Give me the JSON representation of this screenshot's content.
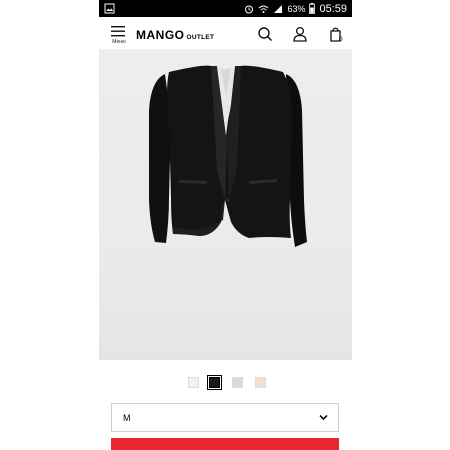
{
  "status_bar": {
    "battery_percent": "63%",
    "time": "05:59",
    "icons": [
      "image-icon",
      "alarm-icon",
      "wifi-icon",
      "signal-icon",
      "battery-icon"
    ]
  },
  "header": {
    "menu_label": "Меню",
    "brand": "MANGO",
    "brand_suffix": "OUTLET",
    "bag_count": "0",
    "icons": [
      "menu-icon",
      "search-icon",
      "user-icon",
      "bag-icon"
    ]
  },
  "product": {
    "image": "black-blazer-photo"
  },
  "colors": {
    "swatches": [
      "#f2f2f2",
      "#1a1a1a",
      "#dadada",
      "#f1e0d2"
    ],
    "selected_index": 1
  },
  "size_selector": {
    "value": "M"
  },
  "theme": {
    "accent": "#e8272f"
  }
}
